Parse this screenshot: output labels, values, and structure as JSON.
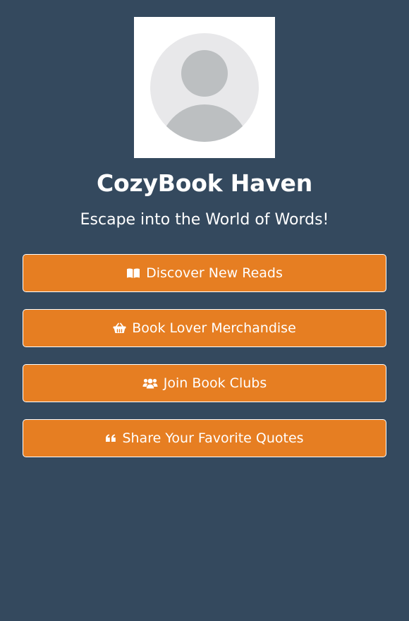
{
  "profile": {
    "avatar_icon": "user-avatar-placeholder-icon",
    "title": "CozyBook Haven",
    "subtitle": "Escape into the World of Words!"
  },
  "links": [
    {
      "label": "Discover New Reads",
      "icon": "book-open-icon"
    },
    {
      "label": "Book Lover Merchandise",
      "icon": "shopping-basket-icon"
    },
    {
      "label": "Join Book Clubs",
      "icon": "users-icon"
    },
    {
      "label": "Share Your Favorite Quotes",
      "icon": "quote-left-icon"
    }
  ],
  "colors": {
    "background": "#34495e",
    "button": "#e67e22",
    "text": "#ffffff",
    "avatar_bg": "#e8e8ea",
    "avatar_figure": "#bcbfc1"
  }
}
